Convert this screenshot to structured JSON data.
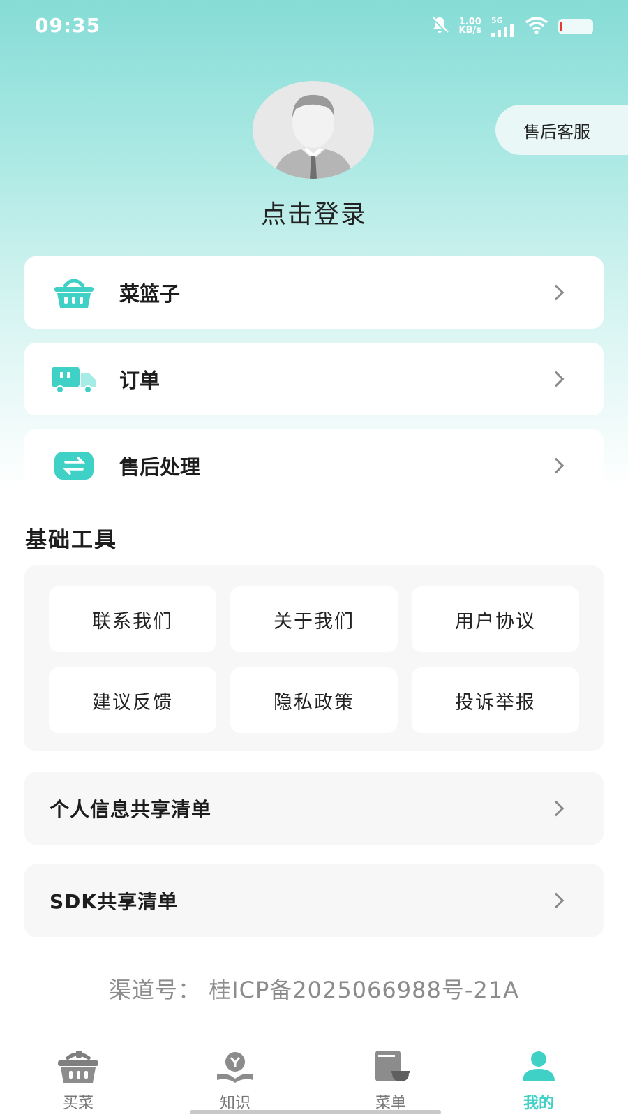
{
  "status_bar": {
    "time": "09:35",
    "net_speed_value": "1.00",
    "net_speed_unit": "KB/s",
    "network": "5G",
    "icons": [
      "bell-muted-icon",
      "signal-icon",
      "wifi-icon",
      "battery-icon"
    ]
  },
  "profile": {
    "login_text": "点击登录",
    "service_button": "售后客服"
  },
  "menu": [
    {
      "label": "菜篮子",
      "icon": "basket-icon"
    },
    {
      "label": "订单",
      "icon": "truck-icon"
    },
    {
      "label": "售后处理",
      "icon": "exchange-icon"
    }
  ],
  "tools": {
    "title": "基础工具",
    "items": [
      "联系我们",
      "关于我们",
      "用户协议",
      "建议反馈",
      "隐私政策",
      "投诉举报"
    ]
  },
  "lists": [
    {
      "label": "个人信息共享清单"
    },
    {
      "label": "SDK共享清单"
    }
  ],
  "footer": {
    "icp": "渠道号：  桂ICP备2025066988号-21A"
  },
  "bottom_nav": [
    {
      "label": "买菜",
      "icon": "basket-nav-icon",
      "active": false
    },
    {
      "label": "知识",
      "icon": "knowledge-icon",
      "active": false
    },
    {
      "label": "菜单",
      "icon": "menu-book-icon",
      "active": false
    },
    {
      "label": "我的",
      "icon": "profile-icon",
      "active": true
    }
  ],
  "colors": {
    "accent": "#3fd0c6",
    "header_gradient_top": "#86dcd6",
    "card_bg": "#f7f7f7"
  }
}
